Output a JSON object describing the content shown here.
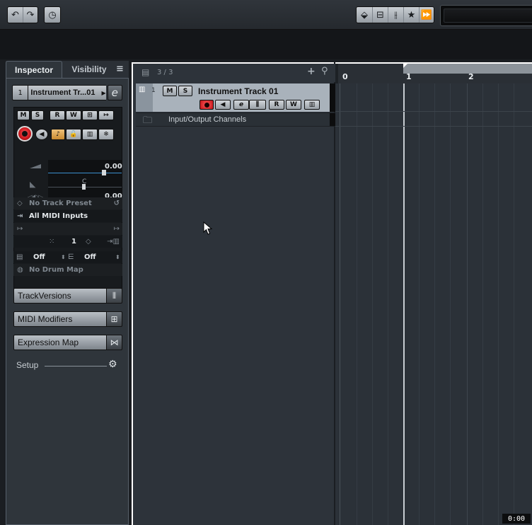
{
  "inspector": {
    "tabs": [
      "Inspector",
      "Visibility"
    ],
    "track_number": "1",
    "track_name": "Instrument Tr...01",
    "volume_value": "0.00",
    "pan_label": "C",
    "pan_value": "0.00",
    "track_preset": "No Track Preset",
    "midi_input": "All MIDI Inputs",
    "midi_channel": "1",
    "transpose_value": "Off",
    "velocity_value": "Off",
    "drum_map": "No Drum Map",
    "sections": [
      "TrackVersions",
      "MIDI Modifiers",
      "Expression Map"
    ],
    "setup_label": "Setup",
    "buttons": {
      "mute": "M",
      "solo": "S",
      "read": "R",
      "write": "W"
    }
  },
  "tracklist": {
    "count": "3 / 3",
    "track1_number": "1",
    "track1_name": "Instrument Track 01",
    "folder_name": "Input/Output Channels"
  },
  "ruler": {
    "bars": [
      "0",
      "1",
      "2"
    ]
  },
  "time_display": "0:00",
  "colors": {
    "record_red": "#d01a1f",
    "track_selected": "#a9b2bb",
    "panel_bg": "#2f353b"
  }
}
